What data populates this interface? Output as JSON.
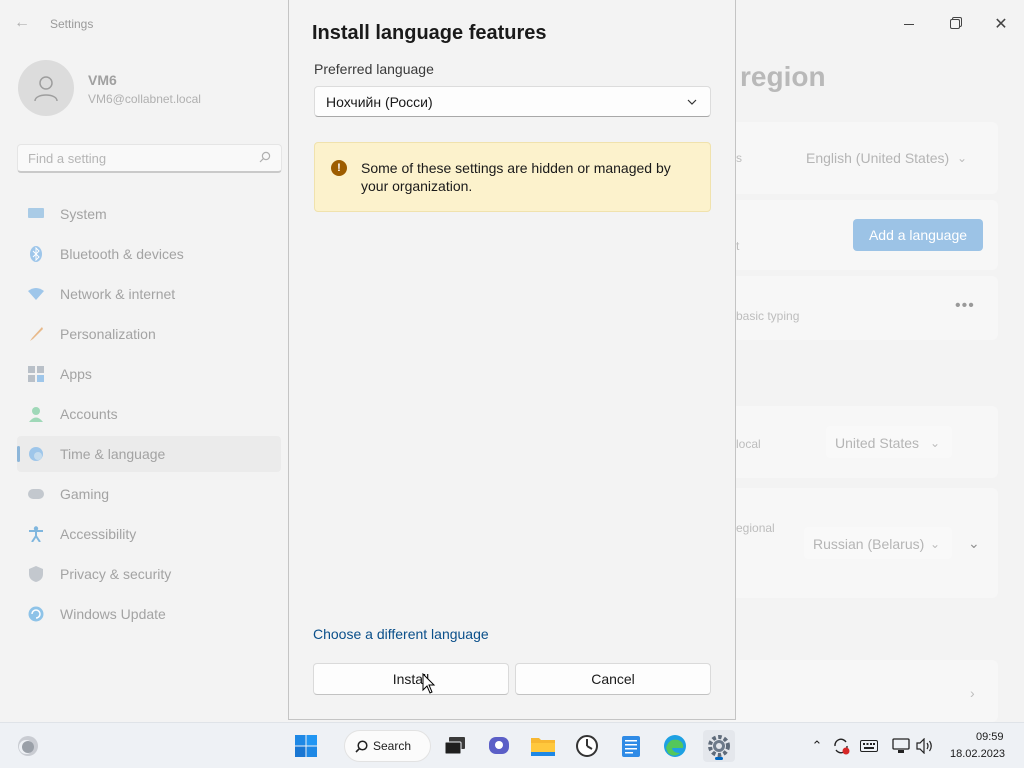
{
  "window": {
    "title": "Settings",
    "back_icon": "arrow-left-icon"
  },
  "user": {
    "name": "VM6",
    "email": "VM6@collabnet.local"
  },
  "search": {
    "placeholder": "Find a setting"
  },
  "sidebar": {
    "items": [
      {
        "label": "System",
        "icon": "monitor-icon",
        "active": false
      },
      {
        "label": "Bluetooth & devices",
        "icon": "bluetooth-icon",
        "active": false
      },
      {
        "label": "Network & internet",
        "icon": "wifi-icon",
        "active": false
      },
      {
        "label": "Personalization",
        "icon": "brush-icon",
        "active": false
      },
      {
        "label": "Apps",
        "icon": "apps-icon",
        "active": false
      },
      {
        "label": "Accounts",
        "icon": "person-icon",
        "active": false
      },
      {
        "label": "Time & language",
        "icon": "globe-clock-icon",
        "active": true
      },
      {
        "label": "Gaming",
        "icon": "gamepad-icon",
        "active": false
      },
      {
        "label": "Accessibility",
        "icon": "accessibility-icon",
        "active": false
      },
      {
        "label": "Privacy & security",
        "icon": "shield-icon",
        "active": false
      },
      {
        "label": "Windows Update",
        "icon": "update-icon",
        "active": false
      }
    ]
  },
  "background_page": {
    "heading_fragment": "region",
    "row1_fragment": "s",
    "display_language": "English (United States)",
    "row2_fragment": "t",
    "add_language_label": "Add a language",
    "row3_fragment": "basic typing",
    "more_label": "•••",
    "row4_fragment": "local",
    "country": "United States",
    "row5_fragment": "egional",
    "regional_format": "Russian (Belarus)"
  },
  "dialog": {
    "title": "Install language features",
    "preferred_language_label": "Preferred language",
    "preferred_language_value": "Нохчийн (Росси)",
    "notice_text": "Some of these settings are hidden or managed by your organization.",
    "notice_icon": "!",
    "choose_different_link": "Choose a different language",
    "install_label": "Install",
    "cancel_label": "Cancel"
  },
  "taskbar": {
    "search_label": "Search",
    "apps": [
      "start-icon",
      "search-icon",
      "task-view-icon",
      "chat-icon",
      "file-explorer-icon",
      "clock-app-icon",
      "notepad-icon",
      "edge-icon",
      "settings-icon"
    ],
    "active_app": "settings-icon",
    "clock_time": "09:59",
    "clock_date": "18.02.2023"
  },
  "colors": {
    "accent": "#0067c0",
    "warning_bg": "#fcf2cc",
    "warning_icon": "#9d5d00",
    "link": "#0a4f8a"
  }
}
